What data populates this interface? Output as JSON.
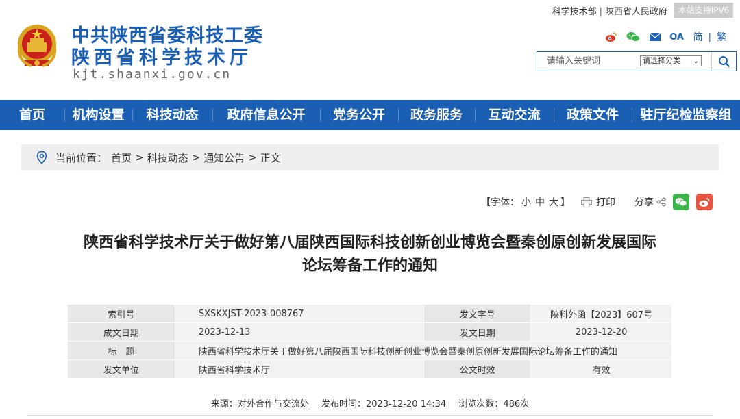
{
  "header": {
    "title_line1": "中共陕西省委科技工委",
    "title_line2": "陕西省科学技术厅",
    "domain": "kjt.shaanxi.gov.cn",
    "top_links": [
      "科学技术部",
      "陕西省人民政府"
    ],
    "ipv6_badge": "本站支持IPV6",
    "icons": [
      "weibo-icon",
      "wechat-icon",
      "mail-icon",
      "oa-icon"
    ],
    "oa_label": "OA",
    "lang_simplified": "简",
    "lang_traditional": "繁",
    "search": {
      "placeholder": "请输入关键词",
      "category_selected": "请选择分类"
    }
  },
  "nav": {
    "items": [
      "首页",
      "机构设置",
      "科技动态",
      "政府信息公开",
      "党务公开",
      "政务服务",
      "互动交流",
      "政策文件",
      "驻厅纪检监察组"
    ]
  },
  "breadcrumb": {
    "label": "当前位置：",
    "path": [
      "首页",
      "科技动态",
      "通知公告",
      "正文"
    ],
    "separator": ">"
  },
  "tools": {
    "font_open": "【字体：",
    "font_small": "小",
    "font_medium": "中",
    "font_large": "大",
    "font_close": "】",
    "print": "打印",
    "share": "分享"
  },
  "article": {
    "title_line1": "陕西省科学技术厅关于做好第八届陕西国际科技创新创业博览会暨秦创原创新发展国际",
    "title_line2": "论坛筹备工作的通知"
  },
  "info": {
    "index_label": "索引号",
    "index_value": "SXSKXJST-2023-008767",
    "doc_no_label": "发文字号",
    "doc_no_value": "陕科外函【2023】607号",
    "written_label": "成文日期",
    "written_value": "2023-12-13",
    "issued_label": "发文日期",
    "issued_value": "2023-12-20",
    "title_label": "标　题",
    "title_value": "陕西省科学技术厅关于做好第八届陕西国际科技创新创业博览会暨秦创原创新发展国际论坛筹备工作的通知",
    "unit_label": "发文单位",
    "unit_value": "陕西省科学技术厅",
    "validity_label": "公文时效",
    "validity_value": "有效"
  },
  "meta": {
    "source": "来源：对外合作与交流处",
    "publish_time": "发布时间：2023-12-20 14:34",
    "views": "浏览次数：486次"
  },
  "colors": {
    "brand_blue": "#1a5fb4",
    "wechat_green": "#3bb54a",
    "weibo_red": "#e8553f"
  }
}
